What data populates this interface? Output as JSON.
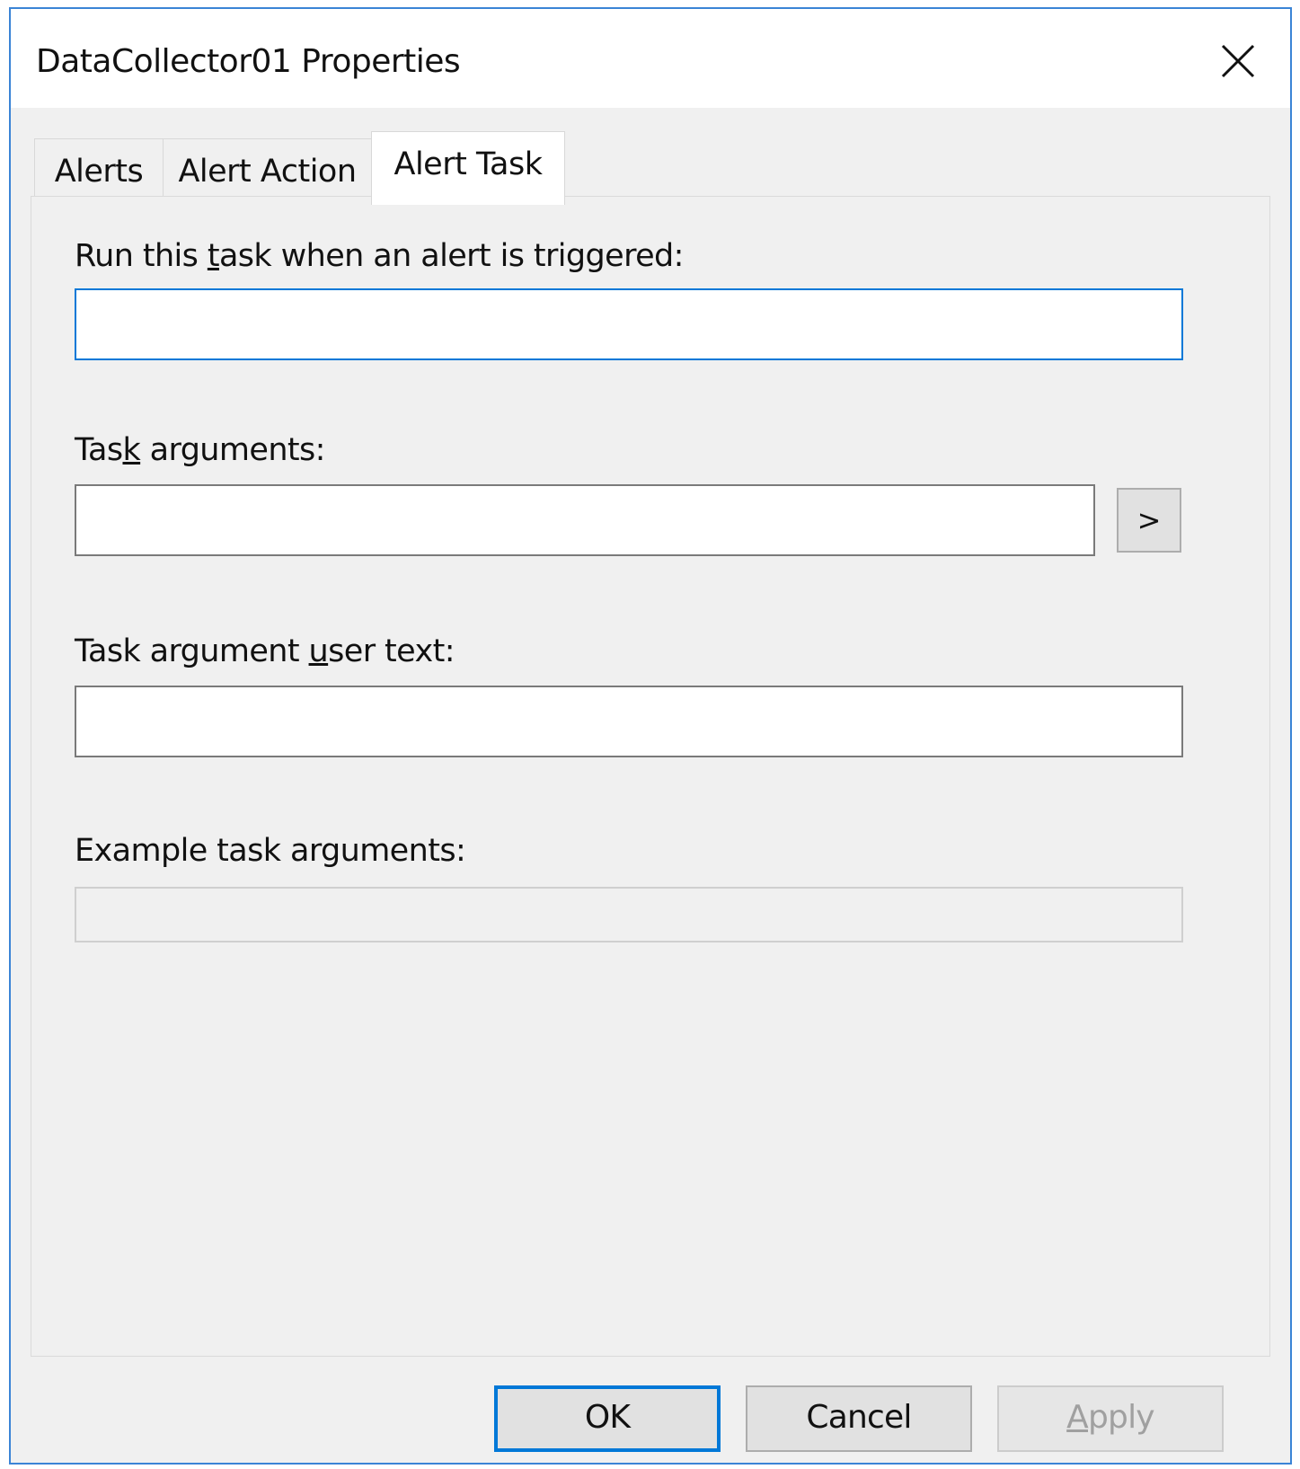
{
  "window": {
    "title": "DataCollector01 Properties"
  },
  "tabs": [
    {
      "label": "Alerts",
      "active": false
    },
    {
      "label": "Alert Action",
      "active": false
    },
    {
      "label": "Alert Task",
      "active": true
    }
  ],
  "form": {
    "run_task": {
      "label_pre": "Run this ",
      "label_mnemonic": "t",
      "label_post": "ask when an alert is triggered:",
      "value": ""
    },
    "task_arguments": {
      "label_pre": "Tas",
      "label_mnemonic": "k",
      "label_post": " arguments:",
      "value": "",
      "browse_label": ">"
    },
    "user_text": {
      "label_pre": "Task argument ",
      "label_mnemonic": "u",
      "label_post": "ser text:",
      "value": ""
    },
    "example": {
      "label": "Example task arguments:",
      "value": ""
    }
  },
  "buttons": {
    "ok": "OK",
    "cancel": "Cancel",
    "apply_mnemonic": "A",
    "apply_rest": "pply"
  },
  "colors": {
    "window_border": "#3b84d6",
    "focus": "#0078d7",
    "dialog_bg": "#f0f0f0"
  },
  "icons": {
    "close": "close-icon"
  }
}
